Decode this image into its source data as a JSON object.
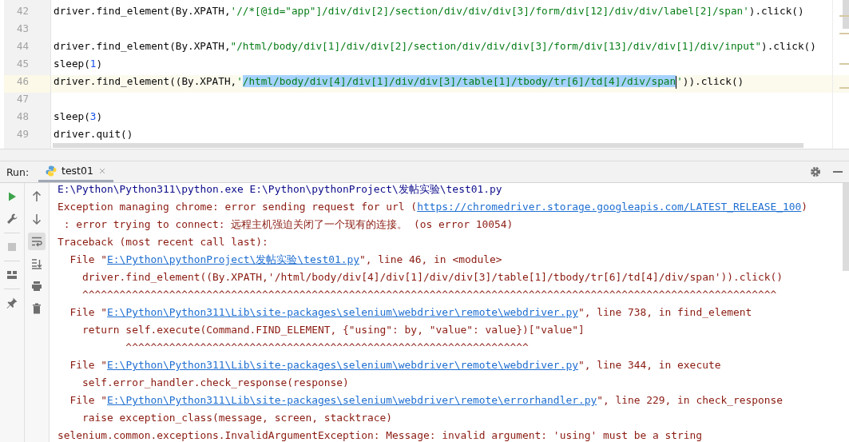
{
  "editor": {
    "lines": [
      {
        "number": "42",
        "current": false,
        "segments": [
          {
            "kind": "plain",
            "text": "driver.find_element(By.XPATH,"
          },
          {
            "kind": "string",
            "text": "'//*[@id=\"app\"]/div/div[2]/section/div/div/div[3]/form/div[12]/div/div/label[2]/span'"
          },
          {
            "kind": "plain",
            "text": ").click()"
          }
        ]
      },
      {
        "number": "43",
        "current": false
      },
      {
        "number": "44",
        "current": false,
        "segments": [
          {
            "kind": "plain",
            "text": "driver.find_element(By.XPATH,"
          },
          {
            "kind": "string",
            "text": "\"/html/body/div[1]/div/div[2]/section/div/div/div[3]/form/div[13]/div/div[1]/div/input\""
          },
          {
            "kind": "plain",
            "text": ").click()"
          }
        ]
      },
      {
        "number": "45",
        "current": false,
        "segments": [
          {
            "kind": "plain",
            "text": "sleep("
          },
          {
            "kind": "number",
            "text": "1"
          },
          {
            "kind": "plain",
            "text": ")"
          }
        ]
      },
      {
        "number": "46",
        "current": true,
        "segments": [
          {
            "kind": "plain",
            "text": "driver.find_element((By.XPATH,"
          },
          {
            "kind": "string",
            "text": "'"
          },
          {
            "kind": "selection",
            "text": "/html/body/div[4]/div[1]/div/div[3]/table[1]/tbody/tr[6]/td[4]/div/span"
          },
          {
            "kind": "string",
            "text": "'"
          },
          {
            "kind": "plain",
            "text": ")).click()"
          }
        ]
      },
      {
        "number": "47",
        "current": false
      },
      {
        "number": "48",
        "current": false,
        "segments": [
          {
            "kind": "plain",
            "text": "sleep("
          },
          {
            "kind": "number",
            "text": "3"
          },
          {
            "kind": "plain",
            "text": ")"
          }
        ]
      },
      {
        "number": "49",
        "current": false,
        "segments": [
          {
            "kind": "plain",
            "text": "driver.quit()"
          }
        ]
      }
    ]
  },
  "run_panel": {
    "label": "Run:",
    "tabs": [
      {
        "label": "test01",
        "selected": true
      }
    ]
  },
  "console": {
    "lines": [
      [
        {
          "kind": "command",
          "text": "E:\\Python\\Python311\\python.exe E:\\Python\\pythonProject\\发帖实验\\test01.py"
        }
      ],
      [
        {
          "kind": "error",
          "text": "Exception managing chrome: error sending request for url ("
        },
        {
          "kind": "link",
          "text": "https://chromedriver.storage.googleapis.com/LATEST_RELEASE_100"
        },
        {
          "kind": "error",
          "text": ")"
        }
      ],
      [
        {
          "kind": "error",
          "text": " : error trying to connect: 远程主机强迫关闭了一个现有的连接。 (os error 10054)"
        }
      ],
      [
        {
          "kind": "error",
          "text": "Traceback (most recent call last):"
        }
      ],
      [
        {
          "kind": "error",
          "text": "  File \""
        },
        {
          "kind": "link",
          "text": "E:\\Python\\pythonProject\\发帖实验\\test01.py"
        },
        {
          "kind": "error",
          "text": "\", line 46, in <module>"
        }
      ],
      [
        {
          "kind": "error",
          "text": "    driver.find_element((By.XPATH,'/html/body/div[4]/div[1]/div/div[3]/table[1]/tbody/tr[6]/td[4]/div/span')).click()"
        }
      ],
      [
        {
          "kind": "error",
          "text": "    ^^^^^^^^^^^^^^^^^^^^^^^^^^^^^^^^^^^^^^^^^^^^^^^^^^^^^^^^^^^^^^^^^^^^^^^^^^^^^^^^^^^^^^^^^^^^^^^^^^^^^^^^^^^^^^^^"
        }
      ],
      [
        {
          "kind": "error",
          "text": "  File \""
        },
        {
          "kind": "link",
          "text": "E:\\Python\\Python311\\Lib\\site-packages\\selenium\\webdriver\\remote\\webdriver.py"
        },
        {
          "kind": "error",
          "text": "\", line 738, in find_element"
        }
      ],
      [
        {
          "kind": "error",
          "text": "    return self.execute(Command.FIND_ELEMENT, {\"using\": by, \"value\": value})[\"value\"]"
        }
      ],
      [
        {
          "kind": "error",
          "text": "           ^^^^^^^^^^^^^^^^^^^^^^^^^^^^^^^^^^^^^^^^^^^^^^^^^^^^^^^^^^^^^^^^^"
        }
      ],
      [
        {
          "kind": "error",
          "text": "  File \""
        },
        {
          "kind": "link",
          "text": "E:\\Python\\Python311\\Lib\\site-packages\\selenium\\webdriver\\remote\\webdriver.py"
        },
        {
          "kind": "error",
          "text": "\", line 344, in execute"
        }
      ],
      [
        {
          "kind": "error",
          "text": "    self.error_handler.check_response(response)"
        }
      ],
      [
        {
          "kind": "error",
          "text": "  File \""
        },
        {
          "kind": "link",
          "text": "E:\\Python\\Python311\\Lib\\site-packages\\selenium\\webdriver\\remote\\errorhandler.py"
        },
        {
          "kind": "error",
          "text": "\", line 229, in check_response"
        }
      ],
      [
        {
          "kind": "error",
          "text": "    raise exception_class(message, screen, stacktrace)"
        }
      ],
      [
        {
          "kind": "error",
          "text": "selenium.common.exceptions.InvalidArgumentException: Message: invalid argument: 'using' must be a string"
        }
      ]
    ]
  }
}
